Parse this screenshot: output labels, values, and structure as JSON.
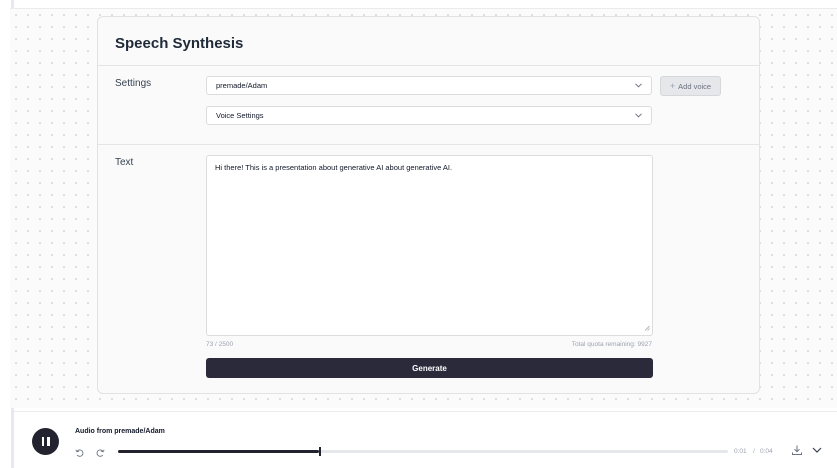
{
  "title": "Speech Synthesis",
  "settings": {
    "label": "Settings",
    "voice_select": "premade/Adam",
    "add_voice_label": "Add voice",
    "voice_settings_label": "Voice Settings"
  },
  "text_section": {
    "label": "Text",
    "value": "Hi there! This is a presentation about generative AI about generative AI.",
    "char_count": "73 / 2500",
    "quota": "Total quota remaining: 9927"
  },
  "generate_label": "Generate",
  "player": {
    "title": "Audio from premade/Adam",
    "current_time": "0:01",
    "separator": "/",
    "duration": "0:04",
    "progress": 0.33,
    "state": "playing"
  },
  "icons": {
    "play_pause": "pause-icon",
    "rewind": "rewind-icon",
    "forward": "forward-icon",
    "download": "download-icon",
    "collapse": "chevron-down-icon"
  },
  "colors": {
    "primary": "#2b2a3b",
    "background": "#fbfbfb"
  }
}
